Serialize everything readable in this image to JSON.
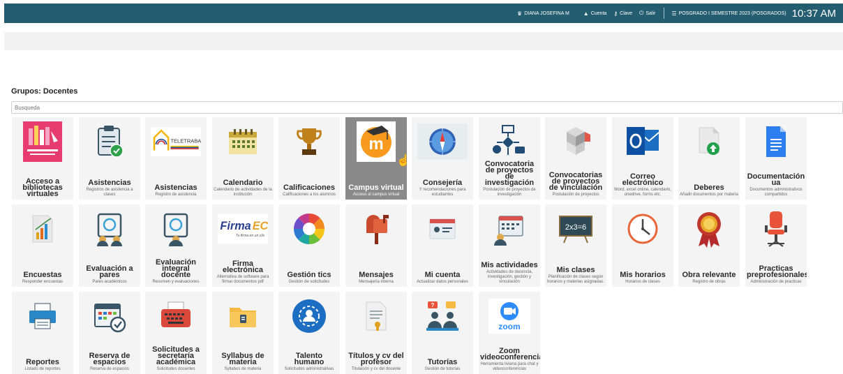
{
  "topbar": {
    "user": "DIANA JOSEFINA M",
    "cuenta": "Cuenta",
    "clave": "Clave",
    "salir": "Salir",
    "periodo": "POSGRADO I SEMESTRE 2023 (POSGRADOS)",
    "time": "10:37 AM"
  },
  "group_title": "Grupos: Docentes",
  "search": {
    "placeholder": "Busqueda"
  },
  "tiles": [
    {
      "title": "Acceso a bibliotecas virtuales",
      "subtitle": "",
      "icon": "library-books-icon"
    },
    {
      "title": "Asistencias",
      "subtitle": "Registros de asistencia a clases",
      "icon": "clipboard-check-icon"
    },
    {
      "title": "Asistencias",
      "subtitle": "Registro de asistencia",
      "icon": "teletrabajo-logo-icon",
      "logo_text": "TELETRABAJO"
    },
    {
      "title": "Calendario",
      "subtitle": "Calendario de actividades de la institución",
      "icon": "calendar-icon"
    },
    {
      "title": "Calificaciones",
      "subtitle": "Calificaciones a los alumnos",
      "icon": "trophy-icon"
    },
    {
      "title": "Campus virtual",
      "subtitle": "Acceso al campus virtual",
      "icon": "moodle-icon",
      "active": true
    },
    {
      "title": "Consejería",
      "subtitle": "Y recomendaciones para estudiantes",
      "icon": "compass-icon"
    },
    {
      "title": "Convocatoria de proyectos de investigación",
      "subtitle": "Postulación de proyectos de investigación",
      "icon": "flowchart-icon"
    },
    {
      "title": "Convocatorias de proyectos de vinculación",
      "subtitle": "Postulación de proyectos",
      "icon": "cubes-icon"
    },
    {
      "title": "Correo electrónico",
      "subtitle": "Word, excel online, calendario, onedrive, forms etc.",
      "icon": "outlook-icon"
    },
    {
      "title": "Deberes",
      "subtitle": "Añadir documentos por materia",
      "icon": "upload-document-icon"
    },
    {
      "title": "Documentación ua",
      "subtitle": "Documentos administrativos compartidos",
      "icon": "google-docs-icon"
    },
    {
      "title": "Encuestas",
      "subtitle": "Responder encuestas",
      "icon": "survey-chart-icon"
    },
    {
      "title": "Evaluación a pares",
      "subtitle": "Pares académicos",
      "icon": "peer-evaluation-icon"
    },
    {
      "title": "Evaluación integral docente",
      "subtitle": "Resumen y evaluaciones",
      "icon": "teacher-evaluation-icon"
    },
    {
      "title": "Firma electrónica",
      "subtitle": "Alternativa de software para firmar documentos pdf",
      "icon": "firmaec-logo-icon",
      "logo_text": "FirmaEC",
      "logo_sub": "Tu firma en un clic"
    },
    {
      "title": "Gestión tics",
      "subtitle": "Gestión de solicitudes",
      "icon": "color-wheel-icon"
    },
    {
      "title": "Mensajes",
      "subtitle": "Mensajería interna",
      "icon": "mailbox-icon"
    },
    {
      "title": "Mi cuenta",
      "subtitle": "Actualizar datos personales",
      "icon": "profile-card-icon"
    },
    {
      "title": "Mis actividades",
      "subtitle": "Actividades de docencia, investigación, gestión y vinculación",
      "icon": "activities-calendar-icon"
    },
    {
      "title": "Mis clases",
      "subtitle": "Planificación de clases según horarios y materias asignadas.",
      "icon": "blackboard-icon",
      "board_text": "2x3=6"
    },
    {
      "title": "Mis horarios",
      "subtitle": "Horarios de clases",
      "icon": "clock-icon"
    },
    {
      "title": "Obra relevante",
      "subtitle": "Registro de obras",
      "icon": "award-medal-icon"
    },
    {
      "title": "Practicas preprofesionales",
      "subtitle": "Administración de practicas",
      "icon": "office-chair-icon"
    },
    {
      "title": "Reportes",
      "subtitle": "Listado de reportes",
      "icon": "printer-icon"
    },
    {
      "title": "Reserva de espacios",
      "subtitle": "Reserva de espacios",
      "icon": "calendar-check-icon"
    },
    {
      "title": "Solicitudes a secretaría académica",
      "subtitle": "Solicitudes docentes",
      "icon": "typewriter-icon"
    },
    {
      "title": "Syllabus de materia",
      "subtitle": "Syllabus de materia",
      "icon": "folder-icon"
    },
    {
      "title": "Talento humano",
      "subtitle": "Solicitudes administrativas",
      "icon": "talent-gear-icon"
    },
    {
      "title": "Títulos y cv del profesor",
      "subtitle": "Titulación y cv del docente",
      "icon": "certificate-icon"
    },
    {
      "title": "Tutorías",
      "subtitle": "Gestión de tutorías",
      "icon": "tutoring-icon"
    },
    {
      "title": "Zoom videoconferencia",
      "subtitle": "Herramienta liviana para chat y videoconferencias",
      "icon": "zoom-icon",
      "logo_text": "zoom"
    }
  ]
}
